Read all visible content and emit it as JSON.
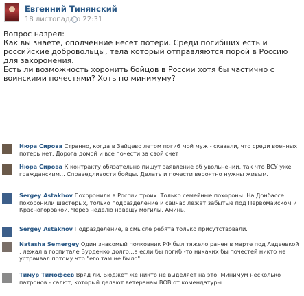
{
  "post": {
    "author": "Евгенний Тинянский",
    "date": "18 листопада о 22:31",
    "paragraphs": [
      "Вопрос назрел:",
      "Как вы знаете, ополченние несет потери. Среди погибших есть и российские добровольцы, тела который отправляются порой в Россию для захоронения.",
      "Есть ли возможность хоронить бойцов в России хотя бы частично с воинскими почестями? Хоть по минимуму?"
    ]
  },
  "comments": [
    {
      "name": "Нюра Сирова",
      "text": "Странно, когда в Зайцево летом поги6 мой муж - сказали, что среди военных потерь нет. Дорога домой и все почести за свой счет",
      "avatar_color": "#6b5a4a"
    },
    {
      "name": "Нюра Сирова",
      "text": "К контракту обязательно пишут заявление об увольнении, так что ВСУ уже гражданским... Справедливости бойцы. Делать и почести вероятно нужны живым.",
      "avatar_color": "#6b5a4a"
    },
    {
      "name": "Sergey Astakhov",
      "text": "Похоронили в России троих. Только семейные похороны. На Донбассе похоронили шестерых, только подразделение и сейчас лежат забытые под Первомайском и Красногоровкой. Через неделю навещу могилы, Аминь.",
      "avatar_color": "#3d5f8a"
    },
    {
      "name": "Sergey Astakhov",
      "text": "Подразделение, в смысле ребята только присутствовали.",
      "avatar_color": "#3d5f8a"
    },
    {
      "name": "Natasha Semergey",
      "text": "Один знакомый полковник РФ был тяжело ранен в марте под Авдеевкой , лежал в госпитале Бурденко долго...а если бы погиб -то никаких бы почестей никто не устраивал потому что \"его там не было\".",
      "avatar_color": "#7a6f68"
    },
    {
      "name": "Тимур Тимофеев",
      "text": "Вряд ли. Бюджет же никто не выделяет на это. Минимум несколько патронов - салют, который делают ветеранам ВОВ от комендатуры.",
      "avatar_color": "#8a8a8a"
    }
  ]
}
